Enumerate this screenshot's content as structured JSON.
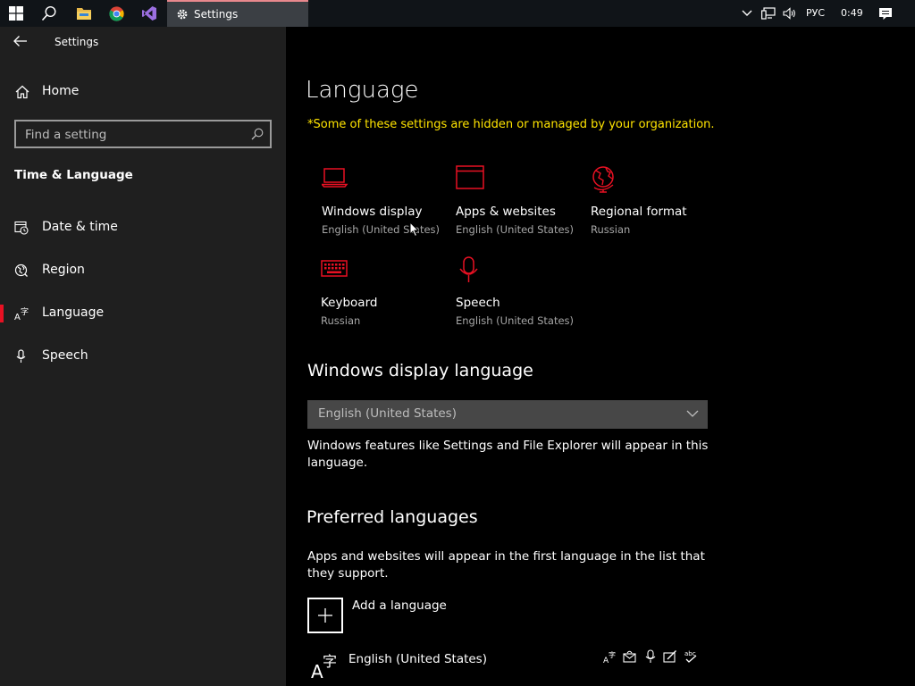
{
  "taskbar": {
    "active_app_label": "Settings",
    "input_language": "РУС",
    "clock": "0:49"
  },
  "window": {
    "title": "Settings"
  },
  "sidebar": {
    "home_label": "Home",
    "search_placeholder": "Find a setting",
    "section_heading": "Time & Language",
    "items": [
      {
        "label": "Date & time",
        "icon": "date-time-icon"
      },
      {
        "label": "Region",
        "icon": "region-globe-icon"
      },
      {
        "label": "Language",
        "icon": "language-icon",
        "selected": true
      },
      {
        "label": "Speech",
        "icon": "microphone-icon"
      }
    ]
  },
  "main": {
    "title": "Language",
    "notice": "*Some of these settings are hidden or managed by your organization.",
    "tiles": [
      {
        "name": "Windows display",
        "value": "English (United States)",
        "icon": "laptop-icon"
      },
      {
        "name": "Apps & websites",
        "value": "English (United States)",
        "icon": "browser-window-icon"
      },
      {
        "name": "Regional format",
        "value": "Russian",
        "icon": "globe-icon"
      },
      {
        "name": "Keyboard",
        "value": "Russian",
        "icon": "keyboard-icon"
      },
      {
        "name": "Speech",
        "value": "English (United States)",
        "icon": "microphone-icon"
      }
    ],
    "display_language": {
      "heading": "Windows display language",
      "selected": "English (United States)",
      "description": "Windows features like Settings and File Explorer will appear in this language."
    },
    "preferred": {
      "heading": "Preferred languages",
      "description": "Apps and websites will appear in the first language in the list that they support.",
      "add_label": "Add a language",
      "languages": [
        {
          "name": "English (United States)"
        }
      ]
    }
  },
  "colors": {
    "accent": "#e81123",
    "notice": "#ffe400",
    "sidebar_bg": "#1f1f1f",
    "main_bg": "#000000"
  }
}
